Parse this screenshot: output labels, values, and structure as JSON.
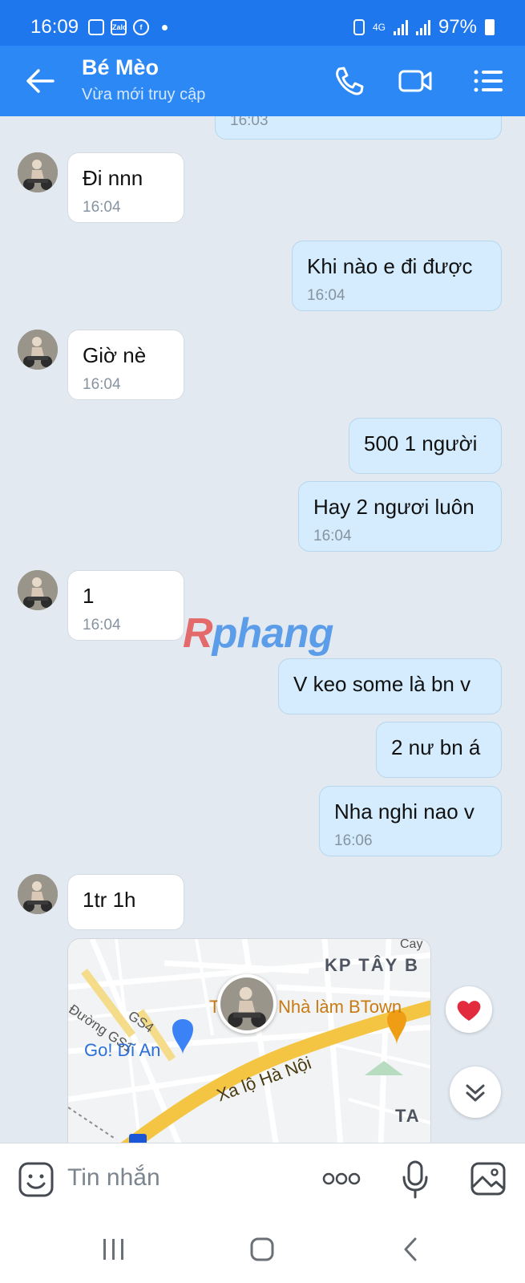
{
  "status_bar": {
    "time": "16:09",
    "zalo_label": "Zalo",
    "network": "4G",
    "battery": "97%"
  },
  "header": {
    "contact_name": "Bé Mèo",
    "status": "Vừa mới truy cập"
  },
  "messages": [
    {
      "dir": "out",
      "text": "",
      "time": "16:03"
    },
    {
      "dir": "in",
      "text": "Đi nnn",
      "time": "16:04"
    },
    {
      "dir": "out",
      "text": "Khi nào e đi được",
      "time": "16:04"
    },
    {
      "dir": "in",
      "text": "Giờ nè",
      "time": "16:04"
    },
    {
      "dir": "out",
      "text": "500 1 người",
      "time": ""
    },
    {
      "dir": "out",
      "text": "Hay 2 ngươi luôn",
      "time": "16:04"
    },
    {
      "dir": "in",
      "text": "1",
      "time": "16:04"
    },
    {
      "dir": "out",
      "text": "V keo some là bn v",
      "time": ""
    },
    {
      "dir": "out",
      "text": "2 nư bn á",
      "time": ""
    },
    {
      "dir": "out",
      "text": "Nha nghi nao v",
      "time": "16:06"
    },
    {
      "dir": "in",
      "text": "1tr 1h",
      "time": ""
    }
  ],
  "map": {
    "labels": {
      "cay": "Cay",
      "kp": "KP TÂY B",
      "place_prefix": "T",
      "place": "Nhà làm BTown",
      "street_gs1": "Đường GS1",
      "street_gs4": "GS4",
      "store": "Go! Dĩ An",
      "highway": "Xa lộ Hà Nội",
      "ta": "TA"
    }
  },
  "watermark": {
    "r": "R",
    "rest": "phang"
  },
  "input": {
    "placeholder": "Tin nhắn"
  },
  "colors": {
    "header": "#2b88f4",
    "status_bar": "#1f77ee",
    "outgoing": "#d4ecfd",
    "chat_bg": "#e2e9f1"
  }
}
